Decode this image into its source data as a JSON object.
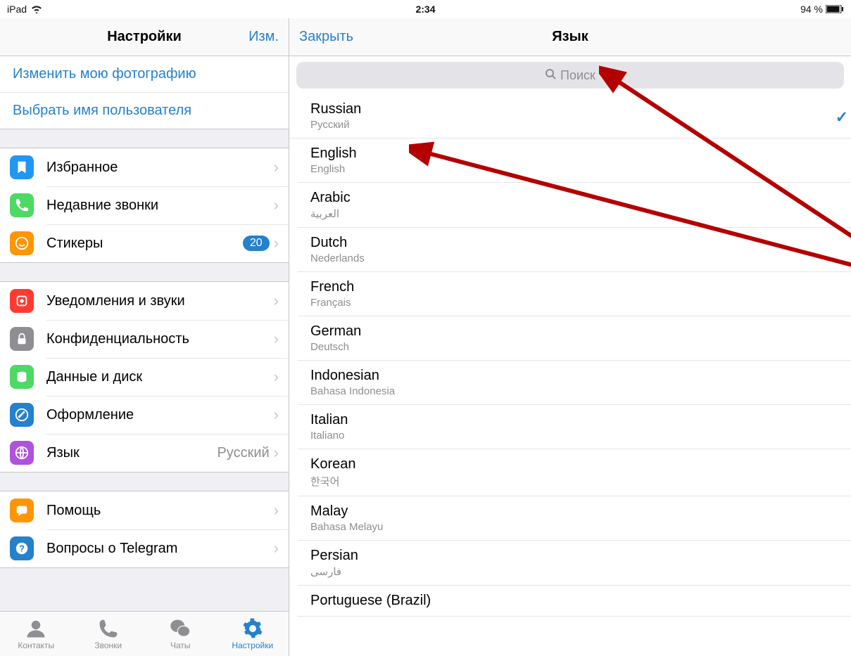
{
  "status": {
    "device": "iPad",
    "time": "2:34",
    "battery": "94 %"
  },
  "left_nav": {
    "title": "Настройки",
    "edit": "Изм."
  },
  "links": {
    "change_photo": "Изменить мою фотографию",
    "choose_username": "Выбрать имя пользователя"
  },
  "settings": {
    "group1": [
      {
        "id": "favorites",
        "label": "Избранное",
        "icon_bg": "#2196f3",
        "icon": "bookmark"
      },
      {
        "id": "recent_calls",
        "label": "Недавние звонки",
        "icon_bg": "#4cd964",
        "icon": "phone"
      },
      {
        "id": "stickers",
        "label": "Стикеры",
        "icon_bg": "#ff9500",
        "icon": "sticker",
        "badge": "20"
      }
    ],
    "group2": [
      {
        "id": "notifications",
        "label": "Уведомления и звуки",
        "icon_bg": "#ff3b30",
        "icon": "bell"
      },
      {
        "id": "privacy",
        "label": "Конфиденциальность",
        "icon_bg": "#8e8e93",
        "icon": "lock"
      },
      {
        "id": "data",
        "label": "Данные и диск",
        "icon_bg": "#4cd964",
        "icon": "disk"
      },
      {
        "id": "appearance",
        "label": "Оформление",
        "icon_bg": "#2481cc",
        "icon": "brush"
      },
      {
        "id": "language",
        "label": "Язык",
        "icon_bg": "#af52de",
        "icon": "globe",
        "value": "Русский"
      }
    ],
    "group3": [
      {
        "id": "help",
        "label": "Помощь",
        "icon_bg": "#ff9500",
        "icon": "chat"
      },
      {
        "id": "faq",
        "label": "Вопросы о Telegram",
        "icon_bg": "#2481cc",
        "icon": "question"
      }
    ]
  },
  "tabs": {
    "contacts": "Контакты",
    "calls": "Звонки",
    "chats": "Чаты",
    "settings": "Настройки"
  },
  "right_nav": {
    "close": "Закрыть",
    "title": "Язык"
  },
  "search": {
    "placeholder": "Поиск"
  },
  "languages": [
    {
      "name": "Russian",
      "native": "Русский",
      "selected": true
    },
    {
      "name": "English",
      "native": "English"
    },
    {
      "name": "Arabic",
      "native": "العربية"
    },
    {
      "name": "Dutch",
      "native": "Nederlands"
    },
    {
      "name": "French",
      "native": "Français"
    },
    {
      "name": "German",
      "native": "Deutsch"
    },
    {
      "name": "Indonesian",
      "native": "Bahasa Indonesia"
    },
    {
      "name": "Italian",
      "native": "Italiano"
    },
    {
      "name": "Korean",
      "native": "한국어"
    },
    {
      "name": "Malay",
      "native": "Bahasa Melayu"
    },
    {
      "name": "Persian",
      "native": "فارسی"
    },
    {
      "name": "Portuguese (Brazil)",
      "native": ""
    }
  ]
}
